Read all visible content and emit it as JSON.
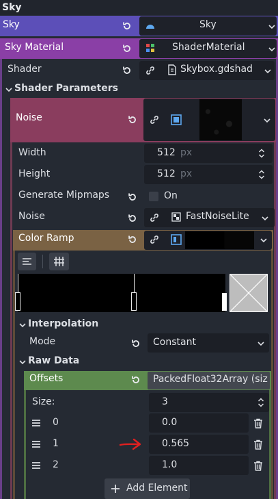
{
  "header": {
    "title": "Sky"
  },
  "sky": {
    "label": "Sky",
    "value": "Sky"
  },
  "sky_material": {
    "label": "Sky Material",
    "value": "ShaderMaterial"
  },
  "shader": {
    "label": "Shader",
    "value": "Skybox.gdshad"
  },
  "shader_parameters": {
    "label": "Shader Parameters"
  },
  "noise_param": {
    "label": "Noise"
  },
  "width": {
    "label": "Width",
    "value": "512",
    "unit": "px"
  },
  "height": {
    "label": "Height",
    "value": "512",
    "unit": "px"
  },
  "mipmaps": {
    "label": "Generate Mipmaps",
    "value": "On"
  },
  "noise_resource": {
    "label": "Noise",
    "value": "FastNoiseLite"
  },
  "color_ramp": {
    "label": "Color Ramp"
  },
  "interpolation": {
    "label": "Interpolation",
    "mode_label": "Mode",
    "mode_value": "Constant"
  },
  "raw_data": {
    "label": "Raw Data"
  },
  "offsets": {
    "label": "Offsets",
    "value": "PackedFloat32Array (siz"
  },
  "size": {
    "label": "Size:",
    "value": "3"
  },
  "rows": [
    {
      "index": "0",
      "value": "0.0"
    },
    {
      "index": "1",
      "value": "0.565"
    },
    {
      "index": "2",
      "value": "1.0"
    }
  ],
  "add_element": {
    "label": "Add Element"
  },
  "colors": {
    "sky_purple": "#5c4fb8",
    "material_purple": "#8a3fa6",
    "noise_pink": "#8a3d5e",
    "ramp_tan": "#7a6244",
    "offsets_green": "#5d8a4e",
    "arrow_red": "#e02020"
  }
}
